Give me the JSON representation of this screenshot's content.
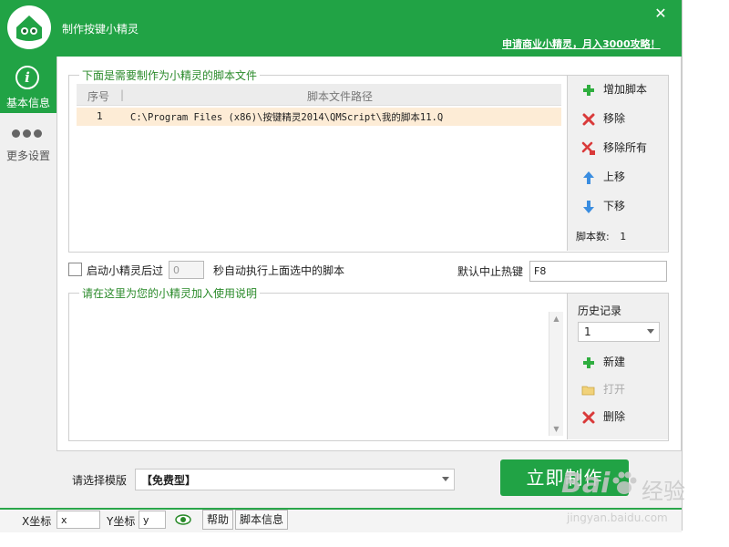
{
  "window": {
    "title": "制作按键小精灵",
    "promo_link": "申请商业小精灵，月入3000攻略！",
    "close_glyph": "✕"
  },
  "sidebar": {
    "items": [
      {
        "label": "基本信息",
        "active": true
      },
      {
        "label": "更多设置",
        "active": false
      }
    ]
  },
  "scripts_group": {
    "legend": "下面是需要制作为小精灵的脚本文件",
    "columns": [
      "序号",
      "脚本文件路径"
    ],
    "rows": [
      {
        "index": "1",
        "path": "C:\\Program Files (x86)\\按键精灵2014\\QMScript\\我的脚本11.Q"
      }
    ],
    "actions": {
      "add": "增加脚本",
      "remove": "移除",
      "remove_all": "移除所有",
      "move_up": "上移",
      "move_down": "下移"
    },
    "count_label": "脚本数:",
    "count_value": "1"
  },
  "autorun": {
    "checkbox_label": "启动小精灵后过",
    "seconds_value": "0",
    "suffix": "秒自动执行上面选中的脚本",
    "checked": false
  },
  "hotkey": {
    "label": "默认中止热键",
    "value": "F8"
  },
  "description_group": {
    "legend": "请在这里为您的小精灵加入使用说明",
    "history_label": "历史记录",
    "history_selected": "1",
    "actions": {
      "new": "新建",
      "open": "打开",
      "delete": "删除"
    }
  },
  "template": {
    "label": "请选择模版",
    "selected": "【免费型】"
  },
  "make_button": "立即制作",
  "statusbar": {
    "x_label": "X坐标",
    "x_value": "x",
    "y_label": "Y坐标",
    "y_value": "y",
    "help": "帮助",
    "script_info": "脚本信息"
  },
  "watermark": {
    "brand": "Bai",
    "brand_suffix": "经验",
    "url": "jingyan.baidu.com"
  },
  "colors": {
    "brand_green": "#21a345",
    "legend_green": "#2a8a2a",
    "selected_row": "#fdecd6",
    "remove_red": "#d93a3a",
    "arrow_blue": "#3a8de0"
  },
  "icons": {
    "logo": "app-logo-icon",
    "info": "info-icon",
    "more": "more-dots-icon",
    "add": "plus-icon",
    "remove": "x-icon",
    "remove_all": "x-multi-icon",
    "up": "arrow-up-icon",
    "down": "arrow-down-icon",
    "open": "folder-icon",
    "eye": "eye-icon"
  }
}
